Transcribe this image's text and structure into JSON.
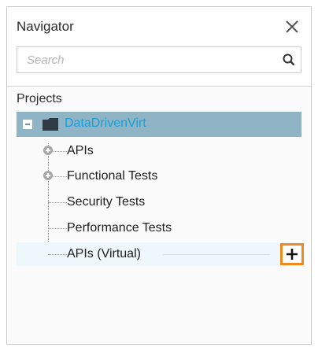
{
  "navigator": {
    "title": "Navigator",
    "search": {
      "placeholder": "Search",
      "value": ""
    },
    "section_label": "Projects",
    "project": {
      "name": "DataDrivenVirt",
      "expanded": true
    },
    "items": [
      {
        "label": "APIs",
        "expandable": true
      },
      {
        "label": "Functional Tests",
        "expandable": true
      },
      {
        "label": "Security Tests",
        "expandable": false
      },
      {
        "label": "Performance Tests",
        "expandable": false
      },
      {
        "label": "APIs (Virtual)",
        "expandable": false,
        "highlighted": true
      }
    ],
    "colors": {
      "selected_row": "#8fb4c6",
      "project_text": "#1a9fd6",
      "add_button_border": "#f08a1c"
    },
    "icons": {
      "close": "close-icon",
      "search": "search-icon",
      "folder": "folder-icon",
      "add": "plus-icon"
    }
  }
}
